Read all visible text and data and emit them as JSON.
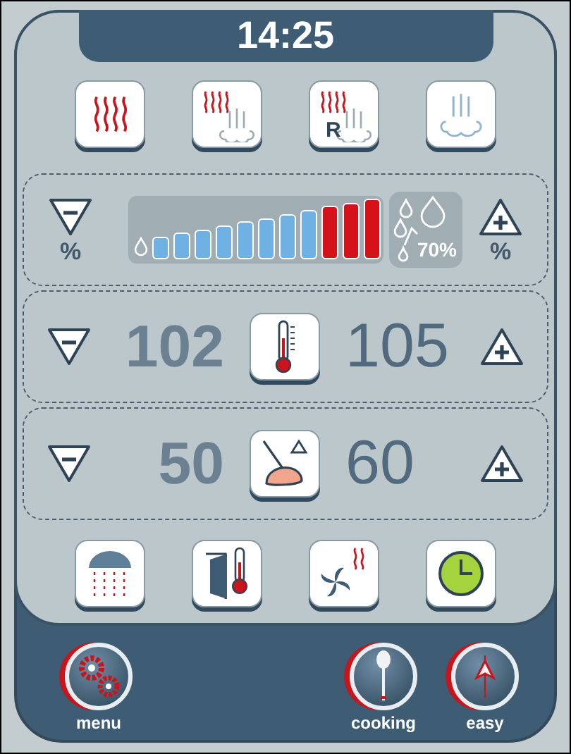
{
  "clock": "14:25",
  "modes": [
    {
      "kind": "hot-air"
    },
    {
      "kind": "combi"
    },
    {
      "kind": "regeneration",
      "label": "R"
    },
    {
      "kind": "steam"
    }
  ],
  "humidity": {
    "minus_label": "%",
    "plus_label": "%",
    "level": 0.73,
    "reading": "70%"
  },
  "temperature": {
    "actual": "102",
    "set": "105"
  },
  "core_temperature": {
    "actual": "50",
    "set": "60"
  },
  "functions": [
    {
      "kind": "shower"
    },
    {
      "kind": "door-temperature"
    },
    {
      "kind": "fan-heat"
    },
    {
      "kind": "timer"
    }
  ],
  "nav": [
    {
      "kind": "menu",
      "label": "menu"
    },
    {
      "kind": "cooking",
      "label": "cooking"
    },
    {
      "kind": "easy",
      "label": "easy"
    }
  ]
}
